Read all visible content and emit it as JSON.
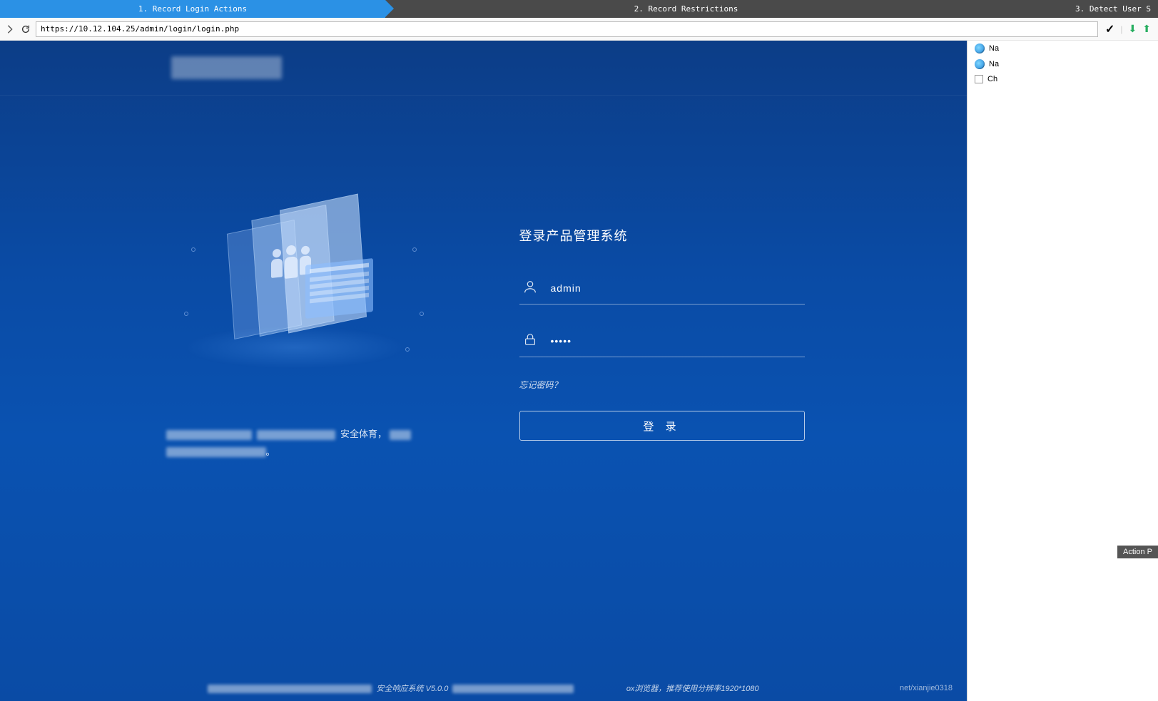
{
  "tabs": {
    "t1": "1. Record Login Actions",
    "t2": "2. Record Restrictions",
    "t3": "3. Detect User S"
  },
  "urlbar": {
    "url": "https://10.12.104.25/admin/login/login.php"
  },
  "rightPanel": {
    "items": [
      "Na",
      "Na",
      "Ch"
    ],
    "actionPanel": "Action P"
  },
  "page": {
    "loginTitle": "登录产品管理系统",
    "username": "admin",
    "passwordMasked": "•••••",
    "forgot": "忘记密码？",
    "loginBtn": "登 录",
    "marketingVisible": "安全体育，",
    "footerVisible": "安全响应系统  V5.0.0",
    "footerBrowser": "ox浏览器，推荐使用分辨率1920*1080",
    "watermark": "net/xianjie0318"
  }
}
